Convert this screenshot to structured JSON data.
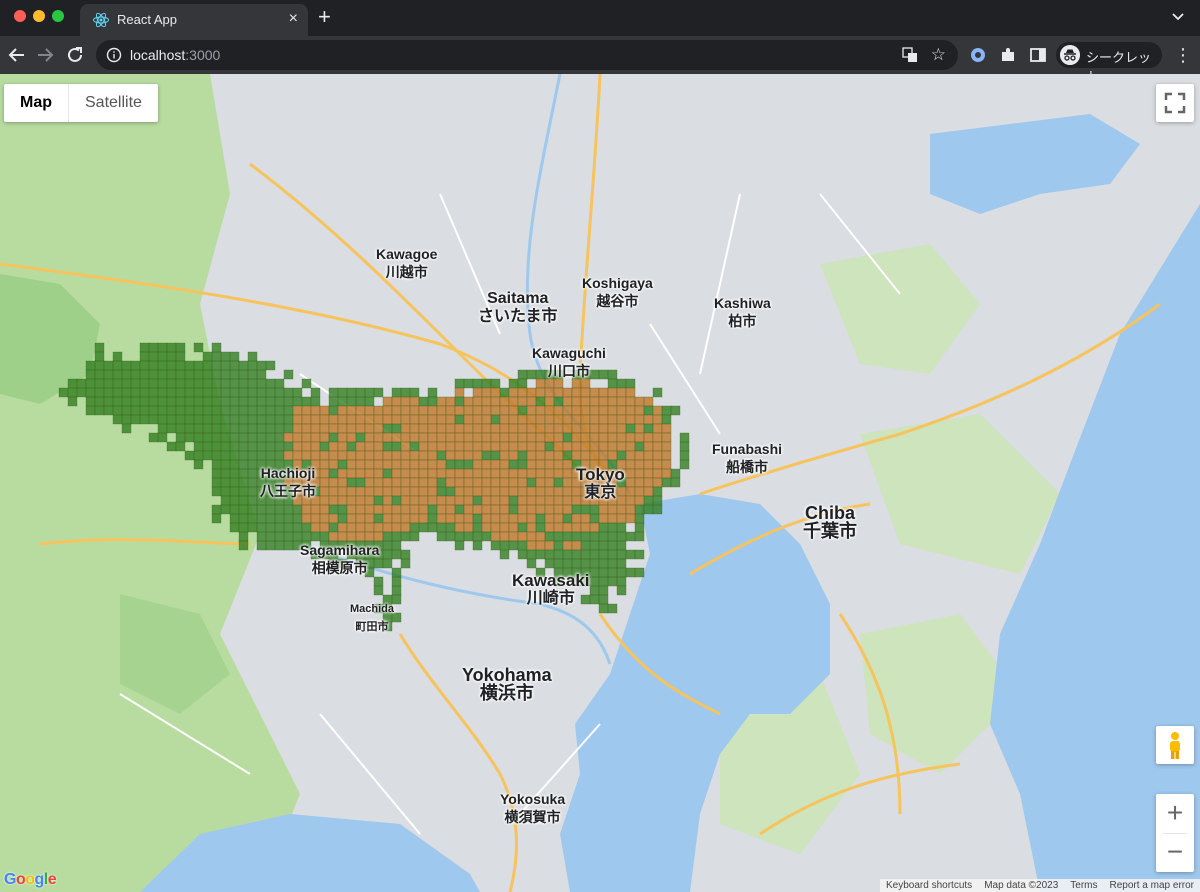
{
  "browser": {
    "tab_title": "React App",
    "tab_close": "×",
    "new_tab": "+",
    "url_host": "localhost",
    "url_port": ":3000",
    "star": "☆",
    "profile_label": "シークレット",
    "menu": "⋮"
  },
  "map": {
    "type_buttons": {
      "map": "Map",
      "satellite": "Satellite"
    },
    "zoom_in": "+",
    "zoom_out": "−",
    "logo": "Google",
    "attribution": {
      "shortcuts": "Keyboard shortcuts",
      "data": "Map data ©2023",
      "terms": "Terms",
      "report": "Report a map error"
    },
    "labels": [
      {
        "en": "Saitama",
        "ja": "さいたま市"
      },
      {
        "en": "Kawagoe",
        "ja": "川越市"
      },
      {
        "en": "Koshigaya",
        "ja": "越谷市"
      },
      {
        "en": "Kawaguchi",
        "ja": "川口市"
      },
      {
        "en": "Tokyo",
        "ja": "東京"
      },
      {
        "en": "Hachioji",
        "ja": "八王子市"
      },
      {
        "en": "Sagamihara",
        "ja": "相模原市"
      },
      {
        "en": "Kawasaki",
        "ja": "川崎市"
      },
      {
        "en": "Yokohama",
        "ja": "横浜市"
      },
      {
        "en": "Chiba",
        "ja": "千葉市"
      },
      {
        "en": "Funabashi",
        "ja": "船橋市"
      },
      {
        "en": "Kashiwa",
        "ja": "柏市"
      },
      {
        "en": "Yokosuka",
        "ja": "横須賀市"
      },
      {
        "en": "Machida",
        "ja": "町田市"
      }
    ]
  },
  "colors": {
    "land": "#dadde1",
    "green": "#b8dca0",
    "water": "#9fc8ee",
    "cell_green": "#2f7d1e",
    "cell_orange": "#c07a2c",
    "cell_border": "#3b5a1a"
  }
}
